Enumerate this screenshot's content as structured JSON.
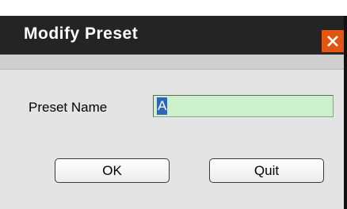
{
  "dialog": {
    "title": "Modify Preset",
    "close_icon": "close-icon"
  },
  "form": {
    "preset_name_label": "Preset Name",
    "preset_name_value": "A"
  },
  "buttons": {
    "ok_label": "OK",
    "quit_label": "Quit"
  },
  "colors": {
    "titlebar": "#242424",
    "close_button": "#e25612",
    "input_background": "#ccf0cc",
    "selection": "#2f66b8",
    "dialog_body": "#e4e4e4"
  }
}
